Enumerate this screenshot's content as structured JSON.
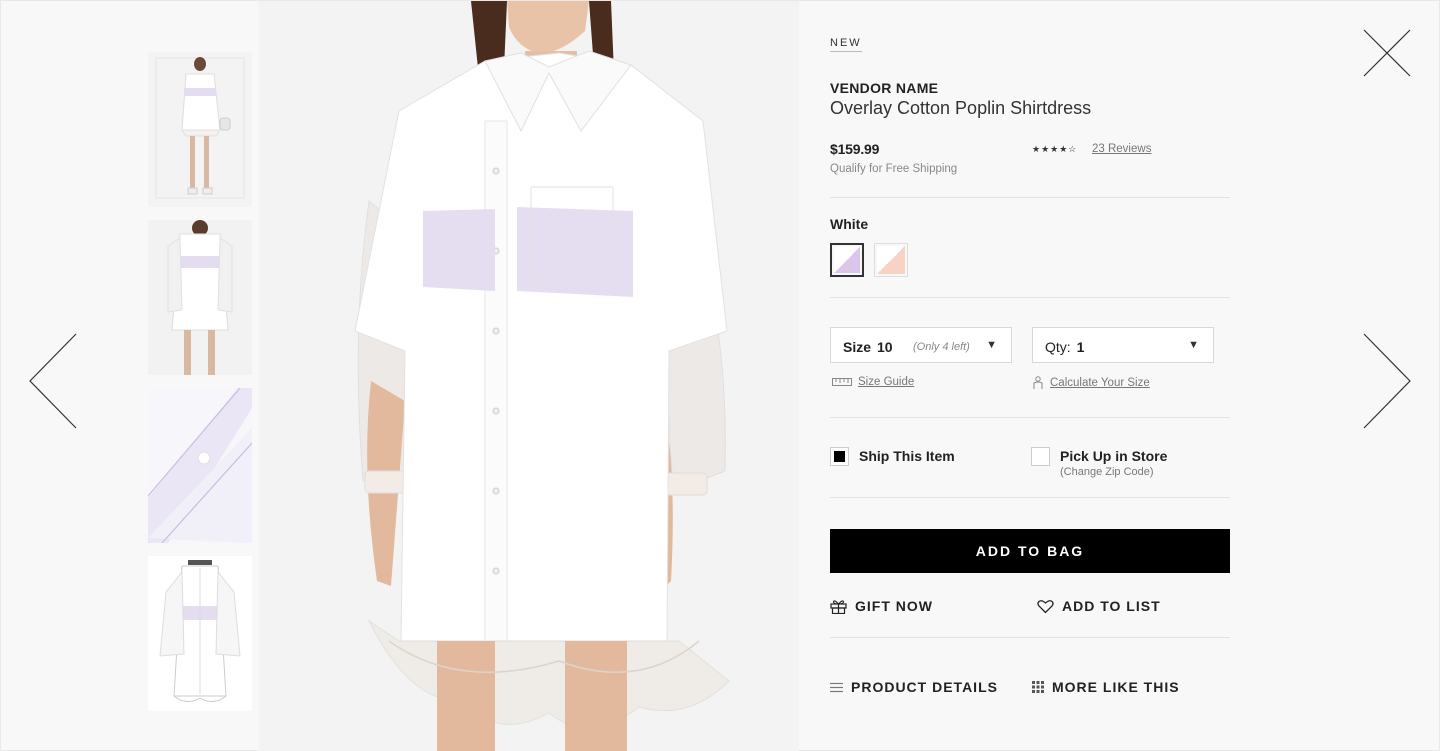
{
  "product": {
    "badge": "NEW",
    "vendor": "VENDOR NAME",
    "title": "Overlay Cotton Poplin Shirtdress",
    "price": "$159.99",
    "shipping_note": "Qualify for Free Shipping",
    "rating_stars": "★★★★☆",
    "rating_value": 4,
    "reviews_label": "23 Reviews"
  },
  "color": {
    "selected_label": "White",
    "swatches": [
      {
        "name": "White",
        "colors": [
          "#ffffff",
          "#dcc5ea"
        ],
        "selected": true
      },
      {
        "name": "Blush",
        "colors": [
          "#ffffff",
          "#f8d2c2"
        ],
        "selected": false
      }
    ]
  },
  "size_select": {
    "label": "Size",
    "value": "10",
    "note": "(Only 4 left)",
    "caret": "▼"
  },
  "qty_select": {
    "label": "Qty:",
    "value": "1",
    "caret": "▼"
  },
  "helpers": {
    "size_guide": "Size Guide",
    "calculate_size": "Calculate Your Size"
  },
  "fulfillment": {
    "ship": {
      "label": "Ship This Item",
      "checked": true
    },
    "pickup": {
      "label": "Pick Up in Store",
      "sub": "(Change Zip Code)",
      "checked": false
    }
  },
  "actions": {
    "add_to_bag": "ADD TO BAG",
    "gift_now": "GIFT NOW",
    "add_to_list": "ADD TO LIST",
    "product_details": "PRODUCT DETAILS",
    "more_like_this": "MORE LIKE THIS"
  },
  "colors": {
    "accent": "#000000",
    "text": "#222222",
    "muted": "#888888",
    "background": "#f8f8f8"
  },
  "icons": {
    "prev": "chevron-left-icon",
    "next": "chevron-right-icon",
    "close": "close-icon",
    "size_guide": "ruler-icon",
    "calculate": "figure-icon",
    "gift": "gift-icon",
    "list": "heart-icon",
    "details": "menu-lines-icon",
    "more": "grid-icon"
  }
}
